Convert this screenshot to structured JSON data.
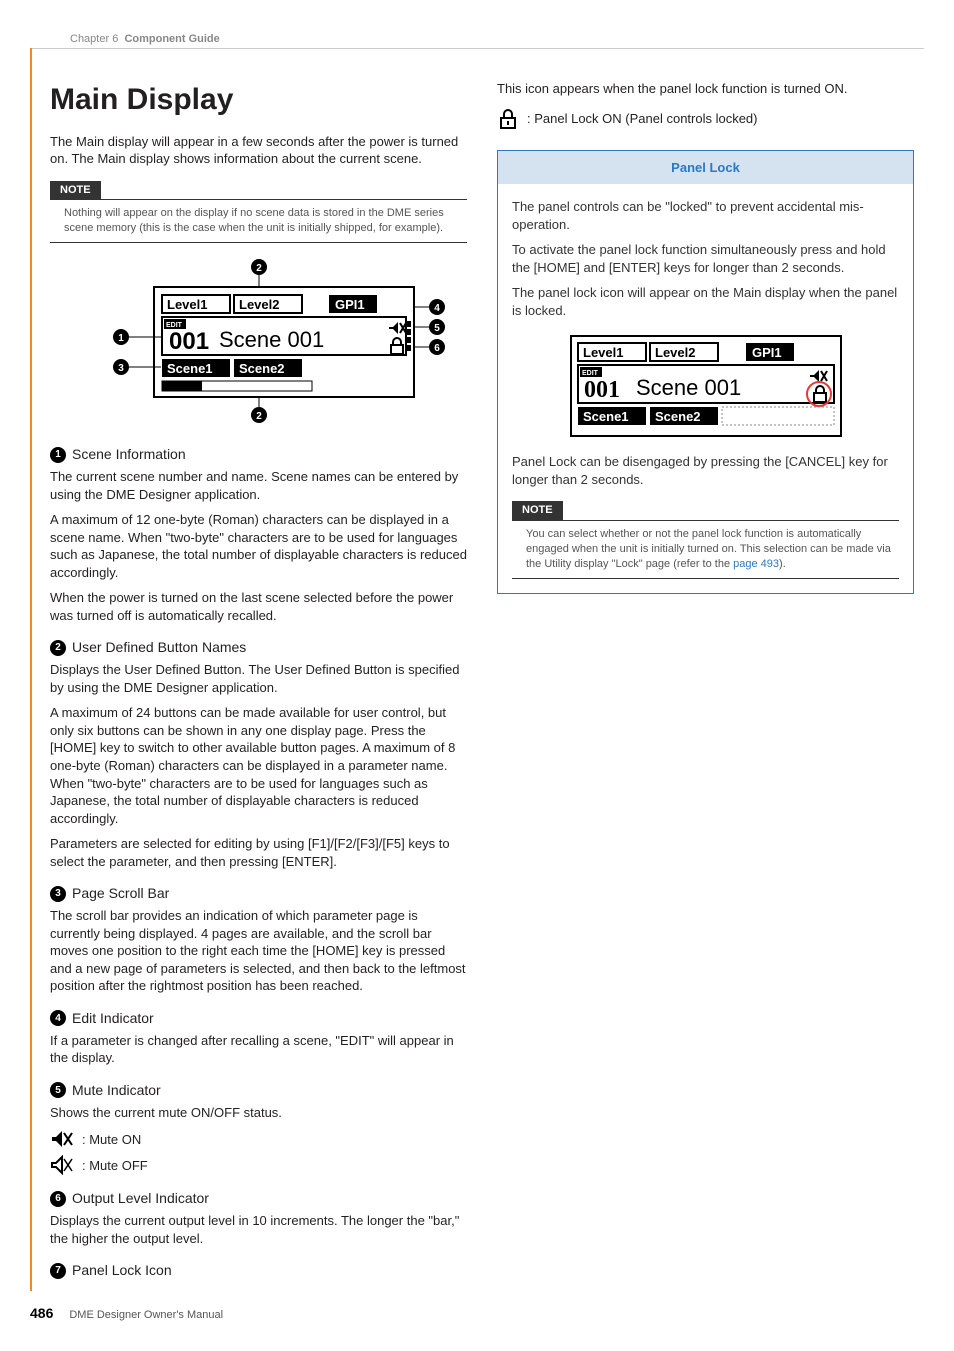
{
  "breadcrumb": {
    "chapter": "Chapter 6",
    "title": "Component Guide"
  },
  "heading": "Main Display",
  "intro": "The Main display will appear in a few seconds after the power is turned on. The Main display shows information about the current scene.",
  "note1": {
    "label": "NOTE",
    "body": "Nothing will appear on the display if no scene data is stored in the DME series scene memory (this is the case when the unit is initially shipped, for example)."
  },
  "lcd": {
    "top1": "Level1",
    "top2": "Level2",
    "top3": "GPI1",
    "edit": "EDIT",
    "num": "001",
    "scene": "Scene 001",
    "bot1": "Scene1",
    "bot2": "Scene2"
  },
  "items": [
    {
      "n": "1",
      "title": "Scene Information",
      "paras": [
        "The current scene number and name. Scene names can be entered by using the DME Designer application.",
        "A maximum of 12 one-byte (Roman) characters can be displayed in a scene name. When \"two-byte\" characters are to be used for languages such as Japanese, the total number of displayable characters is reduced accordingly.",
        "When the power is turned on the last scene selected before the power was turned off is automatically recalled."
      ]
    },
    {
      "n": "2",
      "title": "User Defined Button Names",
      "paras": [
        "Displays the User Defined Button. The User Defined Button is specified by using the DME Designer application.",
        "A maximum of 24 buttons can be made available for user control, but only six buttons can be shown in any one display page. Press the [HOME] key to switch to other available button pages. A maximum of 8 one-byte (Roman) characters can be displayed in a parameter name. When \"two-byte\" characters are to be used for languages such as Japanese, the total number of displayable characters is reduced accordingly.",
        "Parameters are selected for editing by using [F1]/[F2/[F3]/[F5] keys to select the parameter, and then pressing [ENTER]."
      ]
    },
    {
      "n": "3",
      "title": "Page Scroll Bar",
      "paras": [
        "The scroll bar provides an indication of which parameter page is currently being displayed. 4 pages are available, and the scroll bar moves one position to the right each time the [HOME] key is pressed and a new page of parameters is selected, and then back to the leftmost position after the rightmost position has been reached."
      ]
    },
    {
      "n": "4",
      "title": "Edit Indicator",
      "paras": [
        "If a parameter is changed after recalling a scene, \"EDIT\" will appear in the display."
      ]
    },
    {
      "n": "5",
      "title": "Mute Indicator",
      "paras": [
        "Shows the current mute ON/OFF status."
      ],
      "mute_on": ": Mute ON",
      "mute_off": ": Mute OFF"
    },
    {
      "n": "6",
      "title": "Output Level Indicator",
      "paras": [
        "Displays the current output level in 10 increments. The longer the \"bar,\" the higher the output level."
      ]
    },
    {
      "n": "7",
      "title": "Panel Lock Icon",
      "paras": [
        "This icon appears when the panel lock function is turned ON."
      ],
      "lock_text": ": Panel Lock ON (Panel controls locked)"
    }
  ],
  "panel_lock_box": {
    "title": "Panel Lock",
    "p1": "The panel controls can be \"locked\" to prevent accidental mis-operation.",
    "p2": "To activate the panel lock function simultaneously press and hold the [HOME] and [ENTER] keys for longer than 2 seconds.",
    "p3": "The panel lock icon will appear on the Main display when the panel is locked.",
    "p4": "Panel Lock can be disengaged by pressing the [CANCEL] key for longer than 2 seconds.",
    "note_label": "NOTE",
    "note_body_pre": "You can select whether or not the panel lock function is automatically engaged when the unit is initially turned on. This selection can be made via the Utility display \"Lock\" page (refer to the ",
    "note_link": "page 493",
    "note_body_post": ")."
  },
  "footer": {
    "page": "486",
    "text": "DME Designer Owner's Manual"
  }
}
